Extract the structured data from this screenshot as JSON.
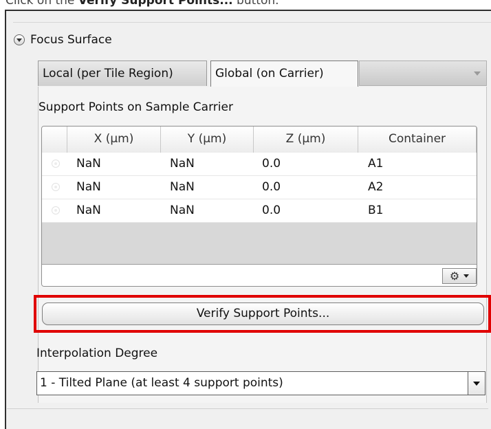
{
  "instruction": {
    "prefix": "Click on the ",
    "bold": "Verify Support Points...",
    "suffix": " button."
  },
  "section": {
    "title": "Focus Surface"
  },
  "tabs": [
    {
      "label": "Local (per Tile Region)"
    },
    {
      "label": "Global (on Carrier)"
    }
  ],
  "support_points_label": "Support Points on Sample Carrier",
  "table": {
    "headers": [
      "X (µm)",
      "Y (µm)",
      "Z (µm)",
      "Container"
    ],
    "rows": [
      {
        "x": "NaN",
        "y": "NaN",
        "z": "0.0",
        "container": "A1"
      },
      {
        "x": "NaN",
        "y": "NaN",
        "z": "0.0",
        "container": "A2"
      },
      {
        "x": "NaN",
        "y": "NaN",
        "z": "0.0",
        "container": "B1"
      }
    ],
    "footer_icon": "gear-icon"
  },
  "verify_button": {
    "label": "Verify Support Points..."
  },
  "interpolation": {
    "label": "Interpolation Degree",
    "selected": "1 - Tilted Plane (at least 4 support points)"
  },
  "colors": {
    "highlight": "#e00000"
  }
}
